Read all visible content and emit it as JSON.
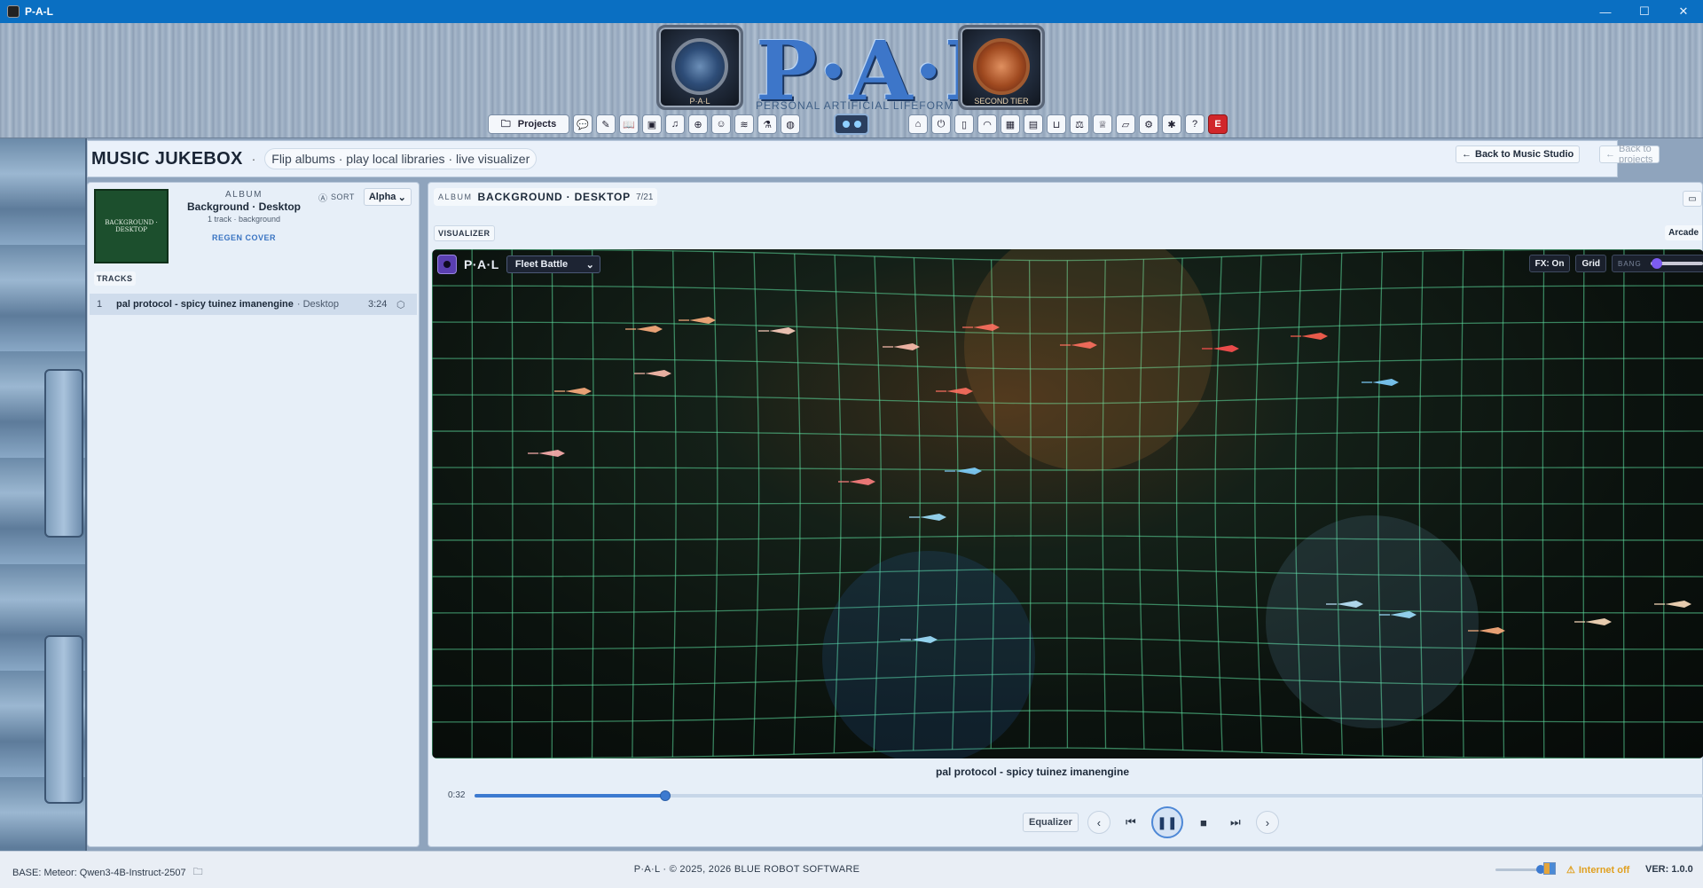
{
  "window": {
    "title": "P-A-L"
  },
  "banner": {
    "logo_text": "P·A·L",
    "logo_subtitle": "PERSONAL ARTIFICIAL LIFEFORM",
    "left_badge_caption": "P·A·L",
    "right_badge_caption": "SECOND TIER"
  },
  "toolbar": {
    "projects_label": "Projects",
    "error_label": "E"
  },
  "page": {
    "title": "MUSIC JUKEBOX",
    "subtitle": "Flip albums · play local libraries · live visualizer",
    "back_studio": "Back to Music Studio",
    "back_projects": "Back to projects"
  },
  "album_card": {
    "cover_text": "BACKGROUND · DESKTOP",
    "label": "ALBUM",
    "name": "Background · Desktop",
    "count": "1 track · background",
    "regen": "REGEN COVER",
    "sort_label": "SORT",
    "sort_value": "Alpha",
    "tracks_label": "TRACKS"
  },
  "tracks": [
    {
      "num": "1",
      "title": "pal protocol - spicy tuinez imanengine",
      "album": "· Desktop",
      "duration": "3:24"
    }
  ],
  "album_view": {
    "label": "ALBUM",
    "name": "BACKGROUND · DESKTOP",
    "position": "7/21",
    "visualizer_tab": "VISUALIZER",
    "arcade": "Arcade"
  },
  "visualizer": {
    "brand": "P·A·L",
    "mode": "Fleet Battle",
    "fx": "FX: On",
    "grid": "Grid",
    "bang_label": "BANG",
    "bang_level": 0.05
  },
  "player": {
    "now_playing": "pal protocol - spicy tuinez imanengine",
    "elapsed": "0:32",
    "progress": 0.155,
    "equalizer": "Equalizer"
  },
  "status": {
    "base": "BASE: Meteor: Qwen3-4B-Instruct-2507",
    "copyright": "P·A·L · © 2025, 2026 BLUE ROBOT SOFTWARE",
    "network": "Internet off",
    "version": "VER: 1.0.0"
  },
  "colors": {
    "titlebar": "#0a6fc2",
    "accent": "#3c7ad0",
    "error": "#d1262a",
    "grid_line": "#5fe0a0"
  }
}
